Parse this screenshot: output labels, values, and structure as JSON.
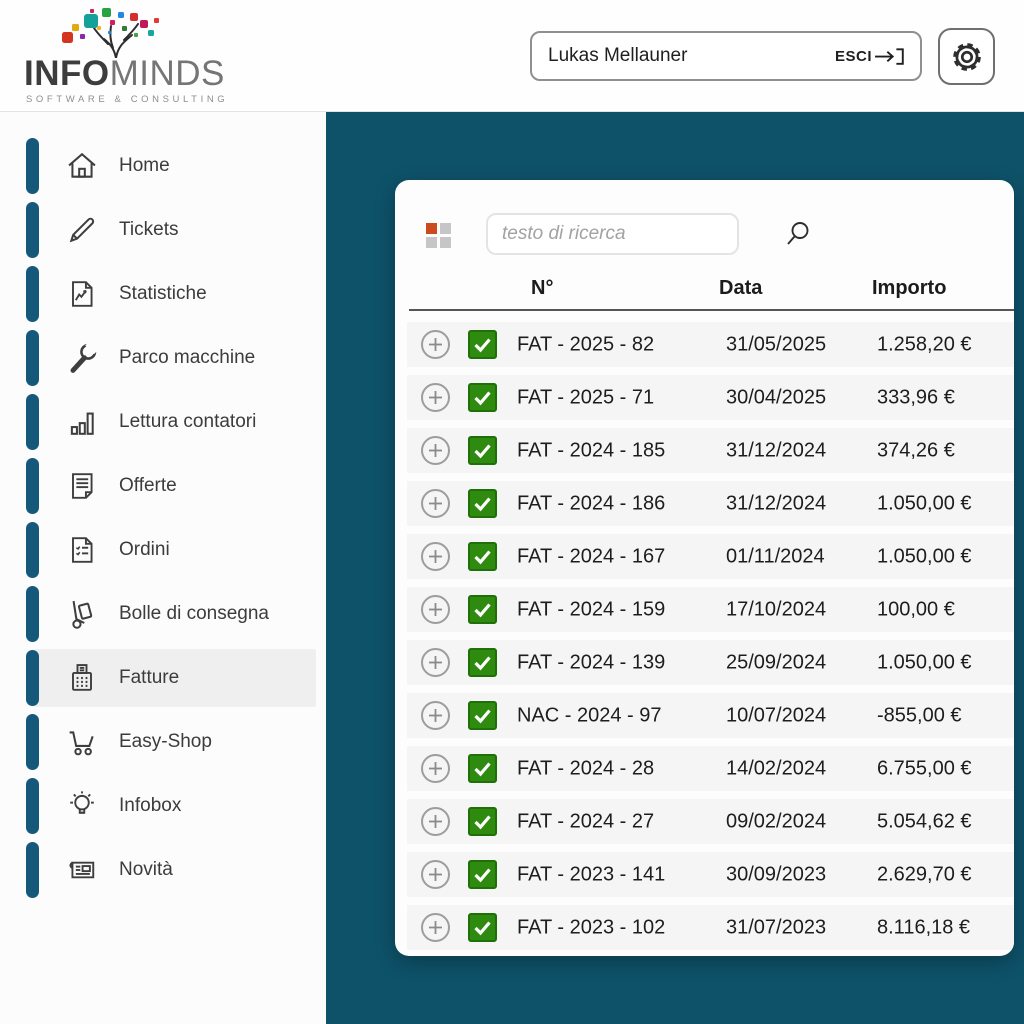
{
  "brand": {
    "name_bold": "INFO",
    "name_light": "MINDS",
    "tagline": "SOFTWARE & CONSULTING"
  },
  "header": {
    "user_name": "Lukas Mellauner",
    "logout_label": "ESCI"
  },
  "sidebar": {
    "items": [
      {
        "label": "Home",
        "icon": "home",
        "active": false
      },
      {
        "label": "Tickets",
        "icon": "pencil",
        "active": false
      },
      {
        "label": "Statistiche",
        "icon": "statistics",
        "active": false
      },
      {
        "label": "Parco macchine",
        "icon": "wrench",
        "active": false
      },
      {
        "label": "Lettura contatori",
        "icon": "barchart",
        "active": false
      },
      {
        "label": "Offerte",
        "icon": "doc-lines",
        "active": false
      },
      {
        "label": "Ordini",
        "icon": "doc-list",
        "active": false
      },
      {
        "label": "Bolle di consegna",
        "icon": "handtruck",
        "active": false
      },
      {
        "label": "Fatture",
        "icon": "register",
        "active": true
      },
      {
        "label": "Easy-Shop",
        "icon": "cart",
        "active": false
      },
      {
        "label": "Infobox",
        "icon": "lightbulb",
        "active": false
      },
      {
        "label": "Novità",
        "icon": "newspaper",
        "active": false
      }
    ]
  },
  "main": {
    "search": {
      "placeholder": "testo di ricerca"
    },
    "table": {
      "columns": [
        "N°",
        "Data",
        "Importo"
      ],
      "rows": [
        {
          "number": "FAT - 2025 - 82",
          "date": "31/05/2025",
          "amount": "1.258,20 €",
          "checked": true
        },
        {
          "number": "FAT - 2025 - 71",
          "date": "30/04/2025",
          "amount": "333,96 €",
          "checked": true
        },
        {
          "number": "FAT - 2024 - 185",
          "date": "31/12/2024",
          "amount": "374,26 €",
          "checked": true
        },
        {
          "number": "FAT - 2024 - 186",
          "date": "31/12/2024",
          "amount": "1.050,00 €",
          "checked": true
        },
        {
          "number": "FAT - 2024 - 167",
          "date": "01/11/2024",
          "amount": "1.050,00 €",
          "checked": true
        },
        {
          "number": "FAT - 2024 - 159",
          "date": "17/10/2024",
          "amount": "100,00 €",
          "checked": true
        },
        {
          "number": "FAT - 2024 - 139",
          "date": "25/09/2024",
          "amount": "1.050,00 €",
          "checked": true
        },
        {
          "number": "NAC - 2024 - 97",
          "date": "10/07/2024",
          "amount": "-855,00 €",
          "checked": true
        },
        {
          "number": "FAT - 2024 - 28",
          "date": "14/02/2024",
          "amount": "6.755,00 €",
          "checked": true
        },
        {
          "number": "FAT - 2024 - 27",
          "date": "09/02/2024",
          "amount": "5.054,62 €",
          "checked": true
        },
        {
          "number": "FAT - 2023 - 141",
          "date": "30/09/2023",
          "amount": "2.629,70 €",
          "checked": true
        },
        {
          "number": "FAT - 2023 - 102",
          "date": "31/07/2023",
          "amount": "8.116,18 €",
          "checked": true
        }
      ]
    }
  },
  "colors": {
    "teal_background": "#0E5269",
    "sidebar_pill": "#16587A",
    "checkbox_green": "#2E8B10",
    "grid_accent_red": "#CB4A1E",
    "row_background": "#F5F5F5",
    "active_item_background": "#EFEFEF"
  }
}
